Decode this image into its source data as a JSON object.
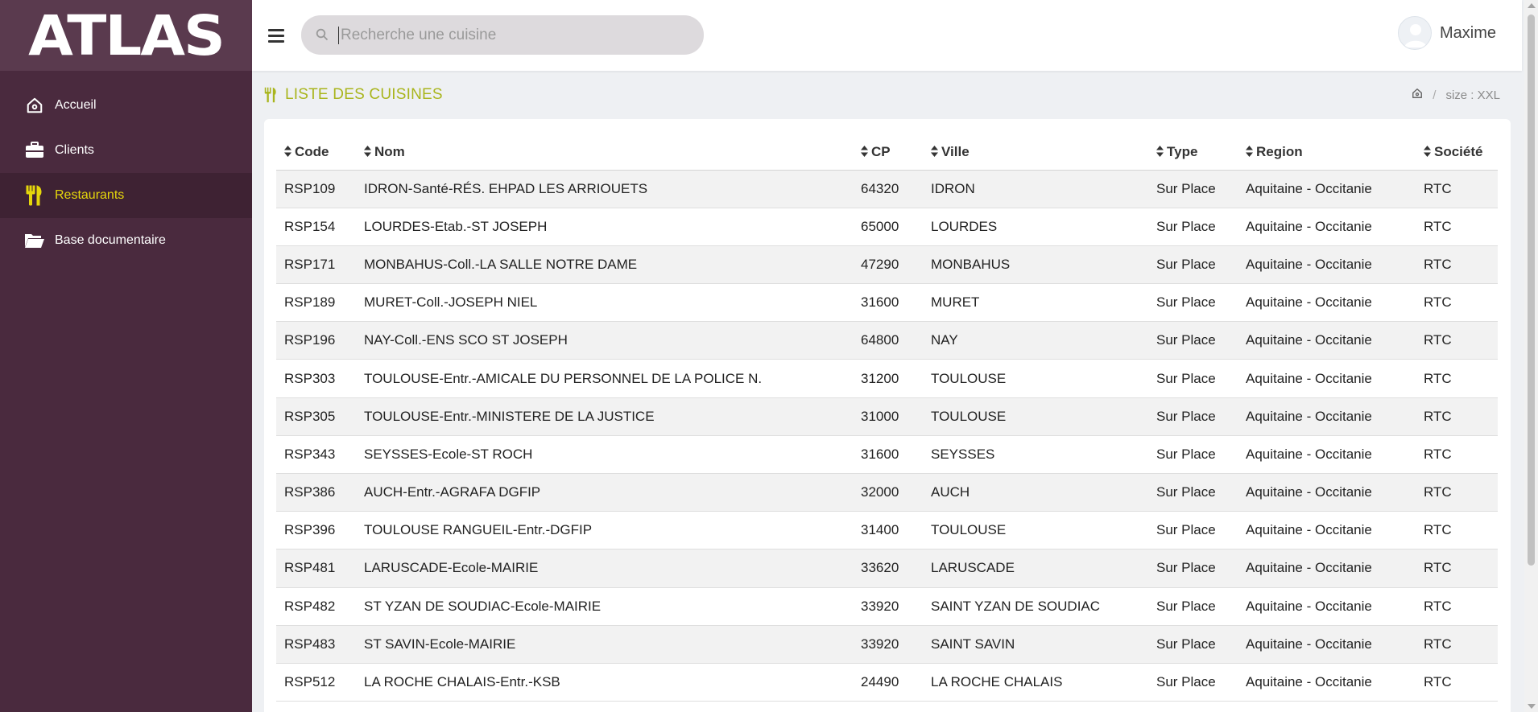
{
  "app": {
    "logo": "ATLAS"
  },
  "sidebar": {
    "items": [
      {
        "label": "Accueil",
        "icon": "home-icon",
        "active": false
      },
      {
        "label": "Clients",
        "icon": "briefcase-icon",
        "active": false
      },
      {
        "label": "Restaurants",
        "icon": "fork-knife-icon",
        "active": true
      },
      {
        "label": "Base documentaire",
        "icon": "folder-open-icon",
        "active": false
      }
    ]
  },
  "topbar": {
    "search": {
      "placeholder": "Recherche une cuisine",
      "value": ""
    },
    "user": {
      "name": "Maxime"
    }
  },
  "page": {
    "title": "LISTE DES CUISINES",
    "breadcrumb": {
      "sep": "/",
      "current": "size : XXL"
    }
  },
  "table": {
    "columns": [
      "Code",
      "Nom",
      "CP",
      "Ville",
      "Type",
      "Region",
      "Société"
    ],
    "rows": [
      [
        "RSP109",
        "IDRON-Santé-RÉS. EHPAD LES ARRIOUETS",
        "64320",
        "IDRON",
        "Sur Place",
        "Aquitaine - Occitanie",
        "RTC"
      ],
      [
        "RSP154",
        "LOURDES-Etab.-ST JOSEPH",
        "65000",
        "LOURDES",
        "Sur Place",
        "Aquitaine - Occitanie",
        "RTC"
      ],
      [
        "RSP171",
        "MONBAHUS-Coll.-LA SALLE NOTRE DAME",
        "47290",
        "MONBAHUS",
        "Sur Place",
        "Aquitaine - Occitanie",
        "RTC"
      ],
      [
        "RSP189",
        "MURET-Coll.-JOSEPH NIEL",
        "31600",
        "MURET",
        "Sur Place",
        "Aquitaine - Occitanie",
        "RTC"
      ],
      [
        "RSP196",
        "NAY-Coll.-ENS SCO ST JOSEPH",
        "64800",
        "NAY",
        "Sur Place",
        "Aquitaine - Occitanie",
        "RTC"
      ],
      [
        "RSP303",
        "TOULOUSE-Entr.-AMICALE DU PERSONNEL DE LA POLICE N.",
        "31200",
        "TOULOUSE",
        "Sur Place",
        "Aquitaine - Occitanie",
        "RTC"
      ],
      [
        "RSP305",
        "TOULOUSE-Entr.-MINISTERE DE LA JUSTICE",
        "31000",
        "TOULOUSE",
        "Sur Place",
        "Aquitaine - Occitanie",
        "RTC"
      ],
      [
        "RSP343",
        "SEYSSES-Ecole-ST ROCH",
        "31600",
        "SEYSSES",
        "Sur Place",
        "Aquitaine - Occitanie",
        "RTC"
      ],
      [
        "RSP386",
        "AUCH-Entr.-AGRAFA DGFIP",
        "32000",
        "AUCH",
        "Sur Place",
        "Aquitaine - Occitanie",
        "RTC"
      ],
      [
        "RSP396",
        "TOULOUSE RANGUEIL-Entr.-DGFIP",
        "31400",
        "TOULOUSE",
        "Sur Place",
        "Aquitaine - Occitanie",
        "RTC"
      ],
      [
        "RSP481",
        "LARUSCADE-Ecole-MAIRIE",
        "33620",
        "LARUSCADE",
        "Sur Place",
        "Aquitaine - Occitanie",
        "RTC"
      ],
      [
        "RSP482",
        "ST YZAN DE SOUDIAC-Ecole-MAIRIE",
        "33920",
        "SAINT YZAN DE SOUDIAC",
        "Sur Place",
        "Aquitaine - Occitanie",
        "RTC"
      ],
      [
        "RSP483",
        "ST SAVIN-Ecole-MAIRIE",
        "33920",
        "SAINT SAVIN",
        "Sur Place",
        "Aquitaine - Occitanie",
        "RTC"
      ],
      [
        "RSP512",
        "LA ROCHE CHALAIS-Entr.-KSB",
        "24490",
        "LA ROCHE CHALAIS",
        "Sur Place",
        "Aquitaine - Occitanie",
        "RTC"
      ]
    ]
  },
  "colors": {
    "sidebar": "#4a2a3e",
    "accent": "#a9b51c",
    "active_text": "#e5d70b"
  }
}
